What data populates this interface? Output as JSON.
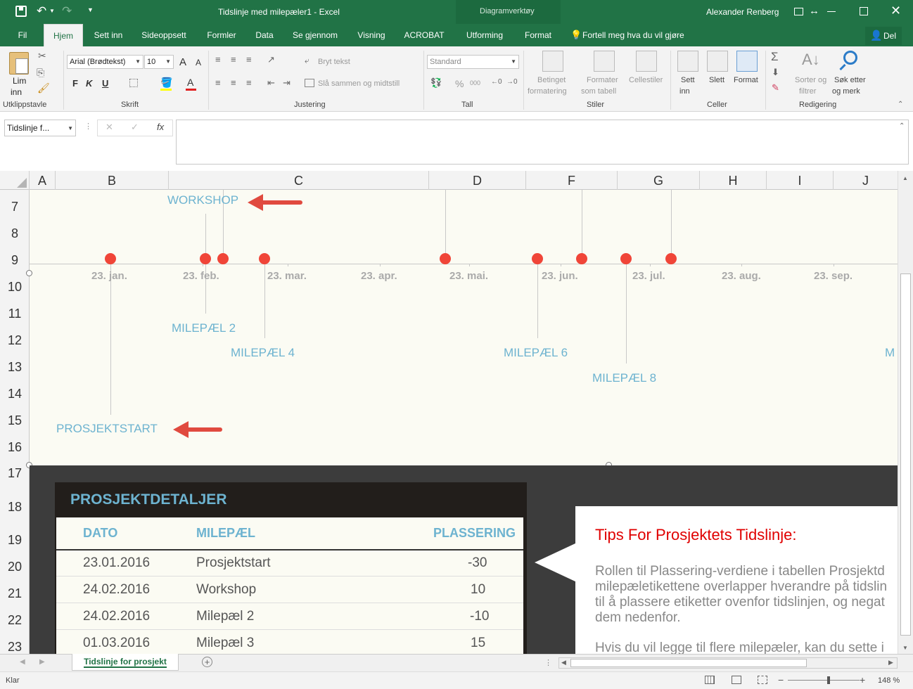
{
  "title_bar": {
    "doc_title": "Tidslinje med milepæler1 - Excel",
    "context_label": "Diagramverktøy",
    "user": "Alexander Renberg"
  },
  "tabs": [
    "Fil",
    "Hjem",
    "Sett inn",
    "Sideoppsett",
    "Formler",
    "Data",
    "Se gjennom",
    "Visning",
    "ACROBAT",
    "Utforming",
    "Format"
  ],
  "active_tab": "Hjem",
  "tell_me": "Fortell meg hva du vil gjøre",
  "share": "Del",
  "ribbon": {
    "clipboard": {
      "paste_1": "Lim",
      "paste_2": "inn",
      "group": "Utklippstavle"
    },
    "font": {
      "name": "Arial (Brødtekst)",
      "size": "10",
      "bold": "F",
      "italic": "K",
      "underline": "U",
      "grow": "A",
      "shrink": "A",
      "group": "Skrift"
    },
    "alignment": {
      "wrap": "Bryt tekst",
      "merge": "Slå sammen og midtstill",
      "group": "Justering"
    },
    "number": {
      "format": "Standard",
      "percent": "%",
      "thousands": "000",
      "group": "Tall"
    },
    "styles": {
      "cond_1": "Betinget",
      "cond_2": "formatering",
      "table_1": "Formater",
      "table_2": "som tabell",
      "cell": "Cellestiler",
      "group": "Stiler"
    },
    "cells": {
      "insert_1": "Sett",
      "insert_2": "inn",
      "delete": "Slett",
      "format": "Format",
      "group": "Celler"
    },
    "editing": {
      "sort_1": "Sorter og",
      "sort_2": "filtrer",
      "find_1": "Søk etter",
      "find_2": "og merk",
      "group": "Redigering"
    }
  },
  "formula_bar": {
    "name_box": "Tidslinje f...",
    "fx": "fx",
    "content": ""
  },
  "columns": [
    "A",
    "B",
    "C",
    "D",
    "F",
    "G",
    "H",
    "I",
    "J"
  ],
  "rows": [
    "7",
    "8",
    "9",
    "10",
    "11",
    "12",
    "13",
    "14",
    "15",
    "16",
    "17",
    "18",
    "19",
    "20",
    "21",
    "22",
    "23"
  ],
  "chart": {
    "axis_dates": [
      "23. jan.",
      "23. feb.",
      "23. mar.",
      "23. apr.",
      "23. mai.",
      "23. jun.",
      "23. jul.",
      "23. aug.",
      "23. sep."
    ],
    "labels": {
      "workshop": "WORKSHOP",
      "m2": "MILEPÆL 2",
      "m4": "MILEPÆL 4",
      "m6": "MILEPÆL 6",
      "m8": "MILEPÆL 8",
      "m_cut": "M",
      "start": "PROSJEKTSTART"
    },
    "colors": {
      "dot": "#f04538",
      "label": "#6db3d0",
      "axis_label": "#aaaaaa",
      "background": "#fbfbf3"
    }
  },
  "details": {
    "title": "PROSJEKTDETALJER",
    "headers": {
      "date": "DATO",
      "milestone": "MILEPÆL",
      "placement": "PLASSERING"
    },
    "rows": [
      {
        "date": "23.01.2016",
        "milestone": "Prosjektstart",
        "placement": "-30"
      },
      {
        "date": "24.02.2016",
        "milestone": "Workshop",
        "placement": "10"
      },
      {
        "date": "24.02.2016",
        "milestone": "Milepæl 2",
        "placement": "-10"
      },
      {
        "date": "01.03.2016",
        "milestone": "Milepæl 3",
        "placement": "15"
      }
    ]
  },
  "tips": {
    "title": "Tips For Prosjektets Tidslinje:",
    "lines": [
      "Rollen til Plassering-verdiene i tabellen Prosjektd",
      "milepæletikettene overlapper hverandre på tidslin",
      "til å plassere etiketter ovenfor tidslinjen, og negat",
      "dem nedenfor.",
      "Hvis du vil legge til flere milepæler, kan du sette i"
    ]
  },
  "sheet_tab": "Tidslinje for prosjekt",
  "status": {
    "ready": "Klar",
    "zoom": "148 %"
  }
}
